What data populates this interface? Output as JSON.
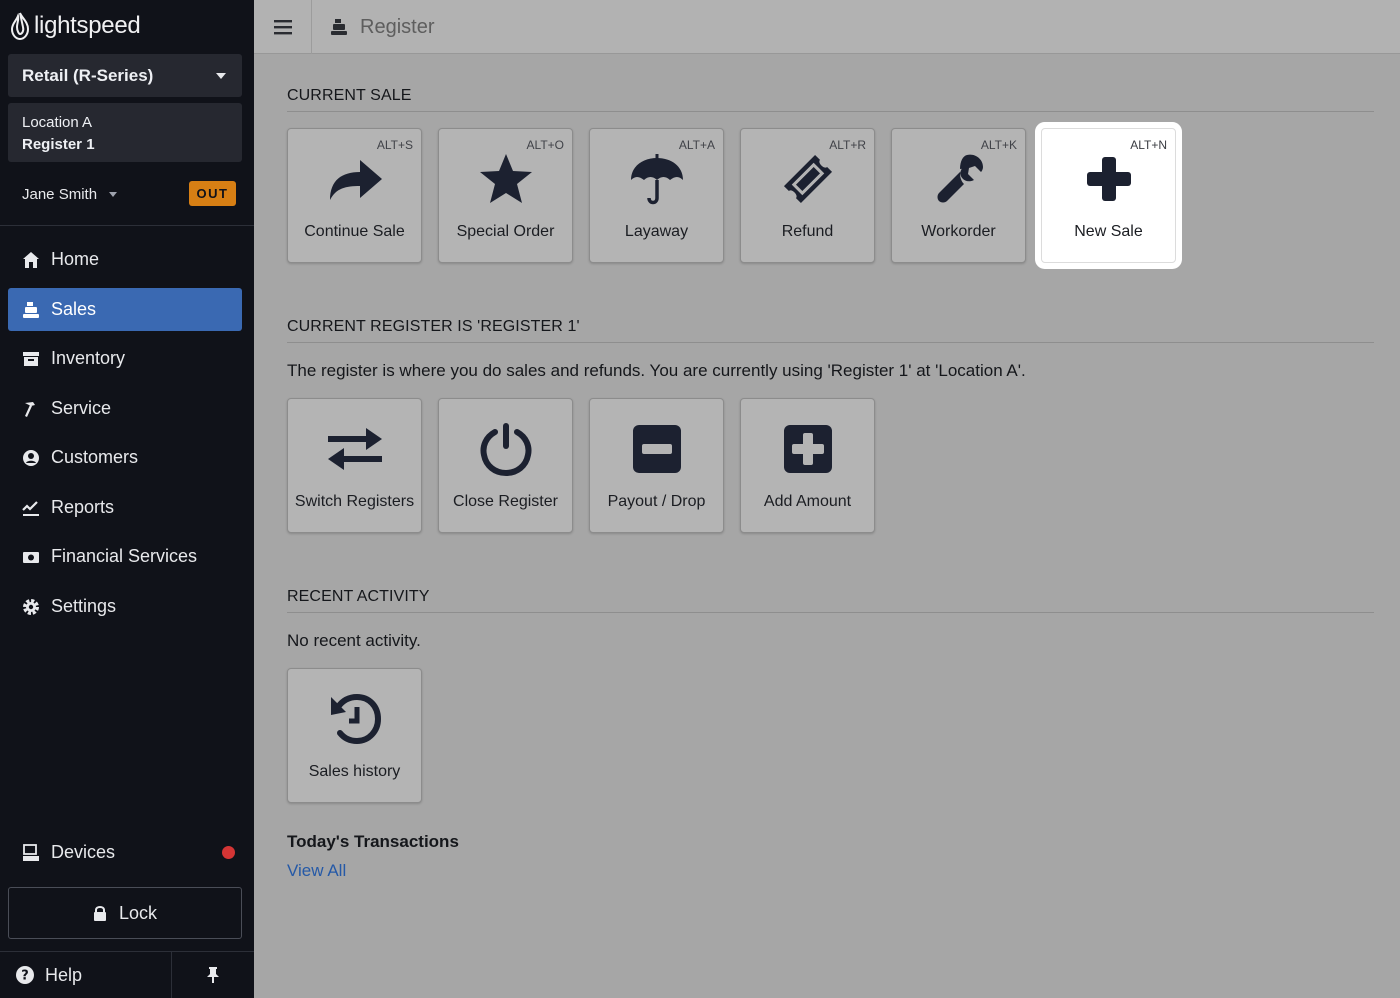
{
  "brand": {
    "name": "lightspeed"
  },
  "sidebar": {
    "account_select": "Retail (R-Series)",
    "location": "Location A",
    "register": "Register 1",
    "user": {
      "name": "Jane Smith",
      "status_badge": "OUT"
    },
    "nav": [
      {
        "label": "Home",
        "icon": "home-icon"
      },
      {
        "label": "Sales",
        "icon": "register-icon",
        "active": true
      },
      {
        "label": "Inventory",
        "icon": "inventory-icon"
      },
      {
        "label": "Service",
        "icon": "hammer-icon"
      },
      {
        "label": "Customers",
        "icon": "user-circle-icon"
      },
      {
        "label": "Reports",
        "icon": "chart-icon"
      },
      {
        "label": "Financial Services",
        "icon": "money-icon"
      },
      {
        "label": "Settings",
        "icon": "gear-icon"
      }
    ],
    "devices": {
      "label": "Devices",
      "status_color": "#d43535"
    },
    "lock_label": "Lock",
    "help_label": "Help"
  },
  "topbar": {
    "title": "Register"
  },
  "current_sale": {
    "heading": "CURRENT SALE",
    "tiles": [
      {
        "label": "Continue Sale",
        "shortcut": "ALT+S",
        "icon": "share-arrow-icon"
      },
      {
        "label": "Special Order",
        "shortcut": "ALT+O",
        "icon": "star-icon"
      },
      {
        "label": "Layaway",
        "shortcut": "ALT+A",
        "icon": "umbrella-icon"
      },
      {
        "label": "Refund",
        "shortcut": "ALT+R",
        "icon": "ticket-icon"
      },
      {
        "label": "Workorder",
        "shortcut": "ALT+K",
        "icon": "wrench-icon"
      },
      {
        "label": "New Sale",
        "shortcut": "ALT+N",
        "icon": "plus-icon",
        "highlighted": true
      }
    ]
  },
  "current_register": {
    "heading": "CURRENT REGISTER IS 'REGISTER 1'",
    "description": "The register is where you do sales and refunds. You are currently using 'Register 1'  at 'Location A'.",
    "tiles": [
      {
        "label": "Switch Registers",
        "icon": "swap-arrows-icon"
      },
      {
        "label": "Close Register",
        "icon": "power-icon"
      },
      {
        "label": "Payout / Drop",
        "icon": "minus-square-icon"
      },
      {
        "label": "Add Amount",
        "icon": "plus-square-icon"
      }
    ]
  },
  "recent_activity": {
    "heading": "RECENT ACTIVITY",
    "empty_text": "No recent activity.",
    "tiles": [
      {
        "label": "Sales history",
        "icon": "history-icon"
      }
    ]
  },
  "todays_transactions": {
    "heading": "Today's Transactions",
    "link_label": "View All"
  },
  "colors": {
    "sidebar_bg": "#101219",
    "active_nav": "#3a69b2",
    "badge": "#d77f14",
    "link": "#2559a7",
    "icon_dark": "#1c2130"
  }
}
